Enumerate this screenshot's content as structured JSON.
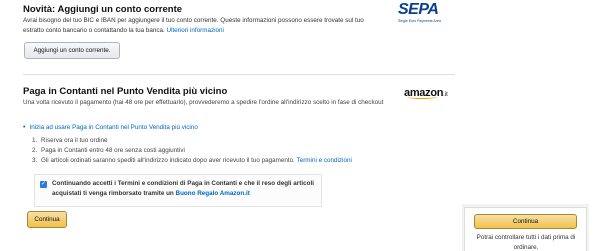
{
  "sepa": {
    "title": "Novità: Aggiungi un conto corrente",
    "description": "Avrai bisogno del tuo BIC e IBAN per aggiungere il tuo conto corrente. Queste informazioni possono essere trovate sul tuo estratto conto bancario o contattando la tua banca.",
    "more_info_link": "Ulteriori informazioni",
    "logo_text": "SEPA",
    "logo_subtext": "Single Euro Payments Area",
    "add_button": "Aggiungi un conto corrente."
  },
  "cod": {
    "title": "Paga in Contanti nel Punto Vendita più vicino",
    "logo_text": "amazon",
    "logo_suffix": ".it",
    "description": "Una volta ricevuto il pagamento (hai 48 ore per effettuarlo), provvederemo a spedire l'ordine all'indirizzo scelto in fase di checkout",
    "start_link": "Inizia ad usare Paga in Contanti nel Punto Vendita più vicino",
    "steps": [
      {
        "num": "1.",
        "text": "Riserva ora il tuo ordine"
      },
      {
        "num": "2.",
        "text": "Paga in Contanti entro 48 ore senza costi aggiuntivi"
      },
      {
        "num": "3.",
        "text": "Gli articoli ordinati saranno spediti all'indirizzo indicato dopo aver ricevuto il tuo pagamento.",
        "link": "Termini e condizioni"
      }
    ],
    "consent_text": "Continuando accetti i Termini e condizioni di Paga in Contanti e che il reso degli articoli acquistati ti venga rimborsato tramite un",
    "consent_link": "Buono Regalo Amazon.it",
    "consent_checked": true,
    "continue_button": "Continua"
  },
  "side_panel": {
    "continue_button": "Continua",
    "note": "Potrai controllare tutti i dati prima di ordinare."
  },
  "colors": {
    "link": "#0066c0",
    "button_primary": "#f0c14b",
    "checkbox": "#2a7ae2",
    "sepa_brand": "#0a3f8f",
    "amazon_smile": "#ff9900"
  }
}
